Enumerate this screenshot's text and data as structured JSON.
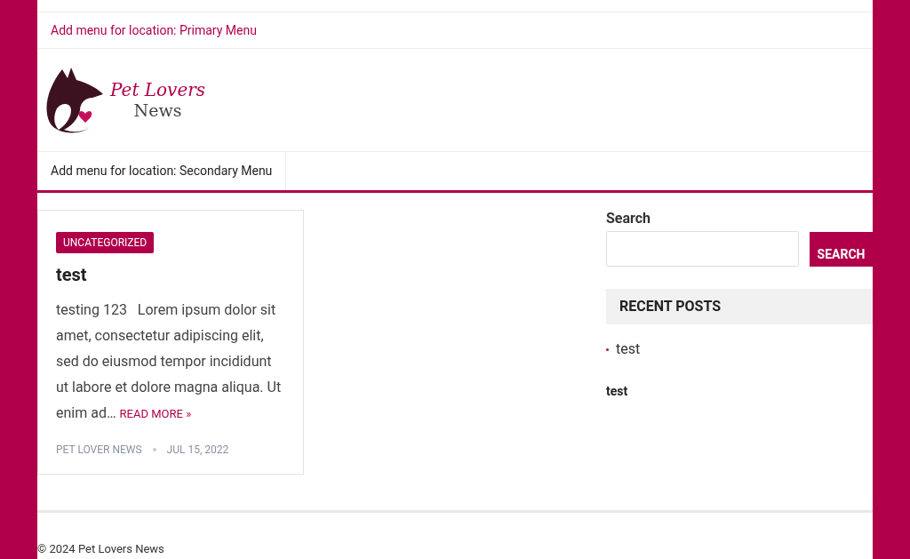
{
  "primary_menu": {
    "label": "Add menu for location: Primary Menu"
  },
  "logo": {
    "line_1": "Pet Lovers",
    "line_2": "News"
  },
  "secondary_menu": {
    "label": "Add menu for location: Secondary Menu"
  },
  "post": {
    "category": "UNCATEGORIZED",
    "title": "test",
    "excerpt": "testing 123   Lorem ipsum dolor sit amet, consectetur adipiscing elit, sed do eiusmod tempor incididunt ut labore et dolore magna aliqua. Ut enim ad…",
    "read_more": "READ MORE »",
    "author": "PET LOVER NEWS",
    "date": "JUL 15, 2022"
  },
  "sidebar": {
    "search_label": "Search",
    "search_button": "SEARCH",
    "recent_posts_title": "RECENT POSTS",
    "recent_posts": [
      "test"
    ],
    "widget_text": "test"
  },
  "footer": {
    "copyright": "© 2024 Pet Lovers News"
  }
}
